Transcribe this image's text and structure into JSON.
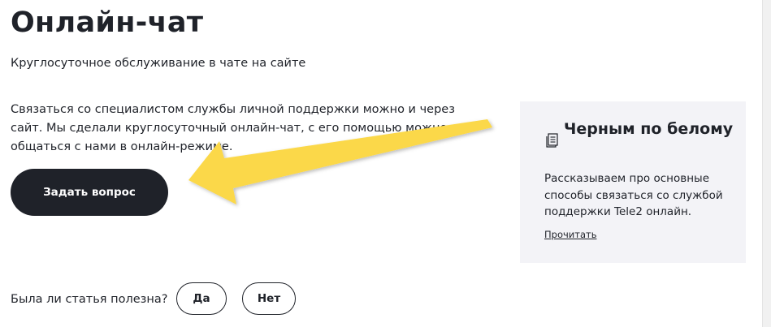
{
  "header": {
    "title": "Онлайн-чат",
    "subtitle": "Круглосуточное обслуживание в чате на сайте"
  },
  "content": {
    "body_text": "Связаться со специалистом службы личной поддержки можно и через сайт. Мы сделали круглосуточный онлайн-чат, с его помощью можно общаться с нами в онлайн-режиме.",
    "ask_button_label": "Задать вопрос"
  },
  "card": {
    "icon": "document-icon",
    "title": "Черным по белому",
    "text": "Рассказываем про основные способы связаться со службой поддержки Tele2 онлайн.",
    "link_label": "Прочитать"
  },
  "feedback": {
    "question": "Была ли статья полезна?",
    "yes_label": "Да",
    "no_label": "Нет"
  },
  "annotation": {
    "arrow_color": "#fbd849"
  },
  "colors": {
    "text": "#1f2229",
    "button_bg": "#1f2229",
    "card_bg": "#f3f3f7"
  }
}
